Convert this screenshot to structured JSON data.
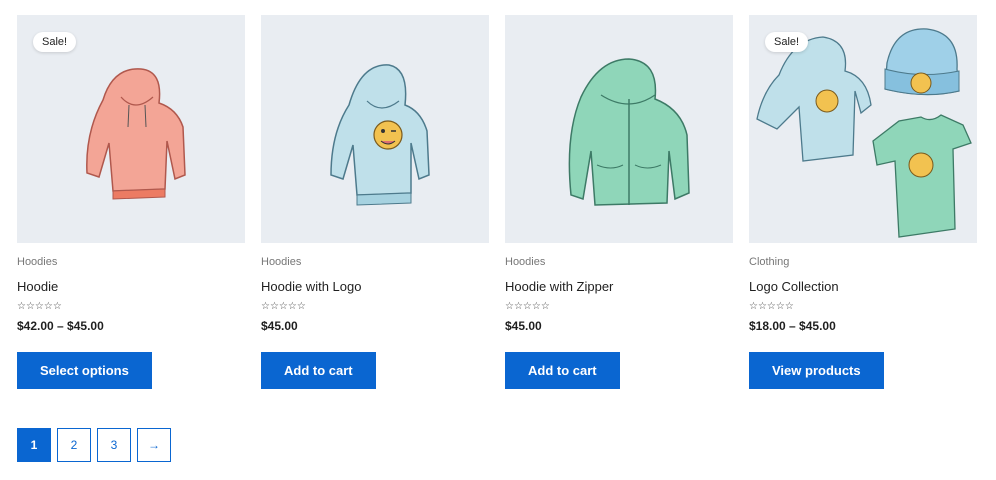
{
  "products": [
    {
      "category": "Hoodies",
      "title": "Hoodie",
      "price": "$42.00 – $45.00",
      "button": "Select options",
      "sale": "Sale!",
      "color": "#f3a596",
      "image": "hoodie-red"
    },
    {
      "category": "Hoodies",
      "title": "Hoodie with Logo",
      "price": "$45.00",
      "button": "Add to cart",
      "sale": "",
      "color": "#bfe0ea",
      "image": "hoodie-logo"
    },
    {
      "category": "Hoodies",
      "title": "Hoodie with Zipper",
      "price": "$45.00",
      "button": "Add to cart",
      "sale": "",
      "color": "#8fd6b9",
      "image": "hoodie-zipper"
    },
    {
      "category": "Clothing",
      "title": "Logo Collection",
      "price": "$18.00 – $45.00",
      "button": "View products",
      "sale": "Sale!",
      "color": "#9fd0e8",
      "image": "logo-collection"
    }
  ],
  "rating_stars": "☆☆☆☆☆",
  "pagination": {
    "pages": [
      "1",
      "2",
      "3"
    ],
    "next": "→",
    "current": "1"
  },
  "colors": {
    "accent": "#0a66d1",
    "thumb_bg": "#e9edf2"
  }
}
